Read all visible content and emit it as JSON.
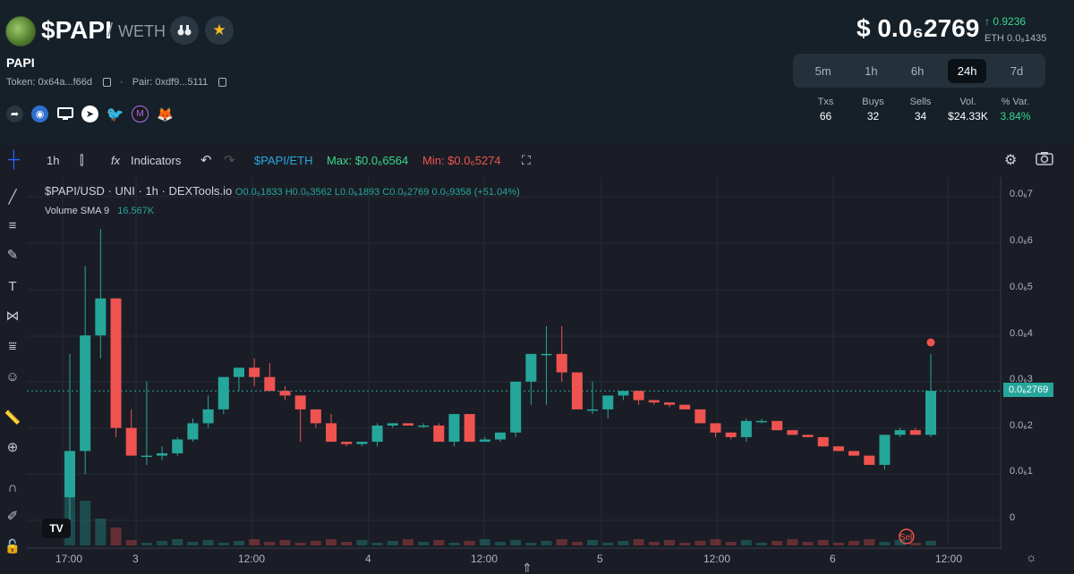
{
  "header": {
    "pair_base": "$PAPI",
    "pair_quote": "WETH",
    "token_name": "PAPI",
    "token_addr": "Token: 0x64a...f66d",
    "pair_addr": "Pair: 0xdf9...5111",
    "price": "$ 0.0₆2769",
    "price_change": "0.9236",
    "price_eth": "ETH 0.0₈1435",
    "timeframes": [
      "5m",
      "1h",
      "6h",
      "24h",
      "7d"
    ],
    "active_timeframe": "24h",
    "stats": {
      "txs_label": "Txs",
      "txs": "66",
      "buys_label": "Buys",
      "buys": "32",
      "sells_label": "Sells",
      "sells": "34",
      "vol_label": "Vol.",
      "vol": "$24.33K",
      "var_label": "% Var.",
      "var": "3.84%"
    }
  },
  "toolbar": {
    "interval": "1h",
    "indicators": "Indicators",
    "symbol": "$PAPI/ETH",
    "max": "Max: $0.0₆6564",
    "min": "Min: $0.0₆5274"
  },
  "legend": {
    "title": "$PAPI/USD · UNI · 1h · DEXTools.io",
    "ohlc": "O0.0₆1833 H0.0₆3562 L0.0₆1893 C0.0₆2769 0.0₅9358 (+51.04%)",
    "volume_label": "Volume SMA 9",
    "volume_value": "16.567K"
  },
  "chart_data": {
    "type": "candlestick",
    "yaxis_ticks": [
      "0.0₆7",
      "0.0₆6",
      "0.0₆5",
      "0.0₆4",
      "0.0₆3",
      "0.0₆2",
      "0.0₆1",
      "0"
    ],
    "xaxis_ticks": [
      "17:00",
      "3",
      "12:00",
      "4",
      "12:00",
      "5",
      "12:00",
      "6",
      "12:00"
    ],
    "last_price_label": "0.0₆2769",
    "sell_marker": "Sell",
    "colors": {
      "up": "#26a69a",
      "down": "#ef5350"
    },
    "candles": [
      [
        0.05,
        0.36,
        0.0,
        0.15
      ],
      [
        0.15,
        0.55,
        0.1,
        0.4
      ],
      [
        0.4,
        0.63,
        0.35,
        0.48
      ],
      [
        0.48,
        0.48,
        0.18,
        0.2
      ],
      [
        0.2,
        0.24,
        0.18,
        0.14
      ],
      [
        0.14,
        0.3,
        0.12,
        0.14
      ],
      [
        0.14,
        0.16,
        0.13,
        0.145
      ],
      [
        0.145,
        0.18,
        0.14,
        0.175
      ],
      [
        0.175,
        0.22,
        0.17,
        0.21
      ],
      [
        0.21,
        0.27,
        0.2,
        0.24
      ],
      [
        0.24,
        0.29,
        0.23,
        0.31
      ],
      [
        0.31,
        0.33,
        0.28,
        0.33
      ],
      [
        0.33,
        0.35,
        0.29,
        0.31
      ],
      [
        0.31,
        0.34,
        0.29,
        0.28
      ],
      [
        0.28,
        0.29,
        0.26,
        0.27
      ],
      [
        0.27,
        0.27,
        0.17,
        0.24
      ],
      [
        0.24,
        0.24,
        0.2,
        0.21
      ],
      [
        0.21,
        0.23,
        0.19,
        0.17
      ],
      [
        0.17,
        0.17,
        0.16,
        0.165
      ],
      [
        0.165,
        0.17,
        0.16,
        0.17
      ],
      [
        0.17,
        0.21,
        0.16,
        0.205
      ],
      [
        0.205,
        0.21,
        0.2,
        0.21
      ],
      [
        0.21,
        0.21,
        0.205,
        0.205
      ],
      [
        0.205,
        0.21,
        0.2,
        0.205
      ],
      [
        0.205,
        0.21,
        0.17,
        0.17
      ],
      [
        0.17,
        0.23,
        0.16,
        0.23
      ],
      [
        0.23,
        0.23,
        0.17,
        0.17
      ],
      [
        0.17,
        0.18,
        0.17,
        0.175
      ],
      [
        0.175,
        0.19,
        0.17,
        0.19
      ],
      [
        0.19,
        0.3,
        0.18,
        0.3
      ],
      [
        0.3,
        0.31,
        0.25,
        0.36
      ],
      [
        0.36,
        0.42,
        0.25,
        0.36
      ],
      [
        0.36,
        0.42,
        0.3,
        0.32
      ],
      [
        0.32,
        0.32,
        0.27,
        0.24
      ],
      [
        0.24,
        0.3,
        0.23,
        0.24
      ],
      [
        0.24,
        0.27,
        0.22,
        0.27
      ],
      [
        0.27,
        0.28,
        0.26,
        0.28
      ],
      [
        0.28,
        0.28,
        0.25,
        0.26
      ],
      [
        0.26,
        0.26,
        0.25,
        0.255
      ],
      [
        0.255,
        0.255,
        0.245,
        0.25
      ],
      [
        0.25,
        0.25,
        0.24,
        0.24
      ],
      [
        0.24,
        0.24,
        0.21,
        0.21
      ],
      [
        0.21,
        0.21,
        0.18,
        0.19
      ],
      [
        0.19,
        0.19,
        0.175,
        0.18
      ],
      [
        0.18,
        0.22,
        0.17,
        0.215
      ],
      [
        0.215,
        0.22,
        0.21,
        0.215
      ],
      [
        0.215,
        0.215,
        0.195,
        0.195
      ],
      [
        0.195,
        0.195,
        0.185,
        0.185
      ],
      [
        0.185,
        0.185,
        0.18,
        0.18
      ],
      [
        0.18,
        0.18,
        0.16,
        0.16
      ],
      [
        0.16,
        0.16,
        0.15,
        0.15
      ],
      [
        0.15,
        0.15,
        0.14,
        0.14
      ],
      [
        0.14,
        0.14,
        0.12,
        0.12
      ],
      [
        0.12,
        0.185,
        0.11,
        0.185
      ],
      [
        0.185,
        0.2,
        0.18,
        0.195
      ],
      [
        0.195,
        0.2,
        0.19,
        0.185
      ],
      [
        0.185,
        0.36,
        0.18,
        0.28
      ]
    ]
  }
}
